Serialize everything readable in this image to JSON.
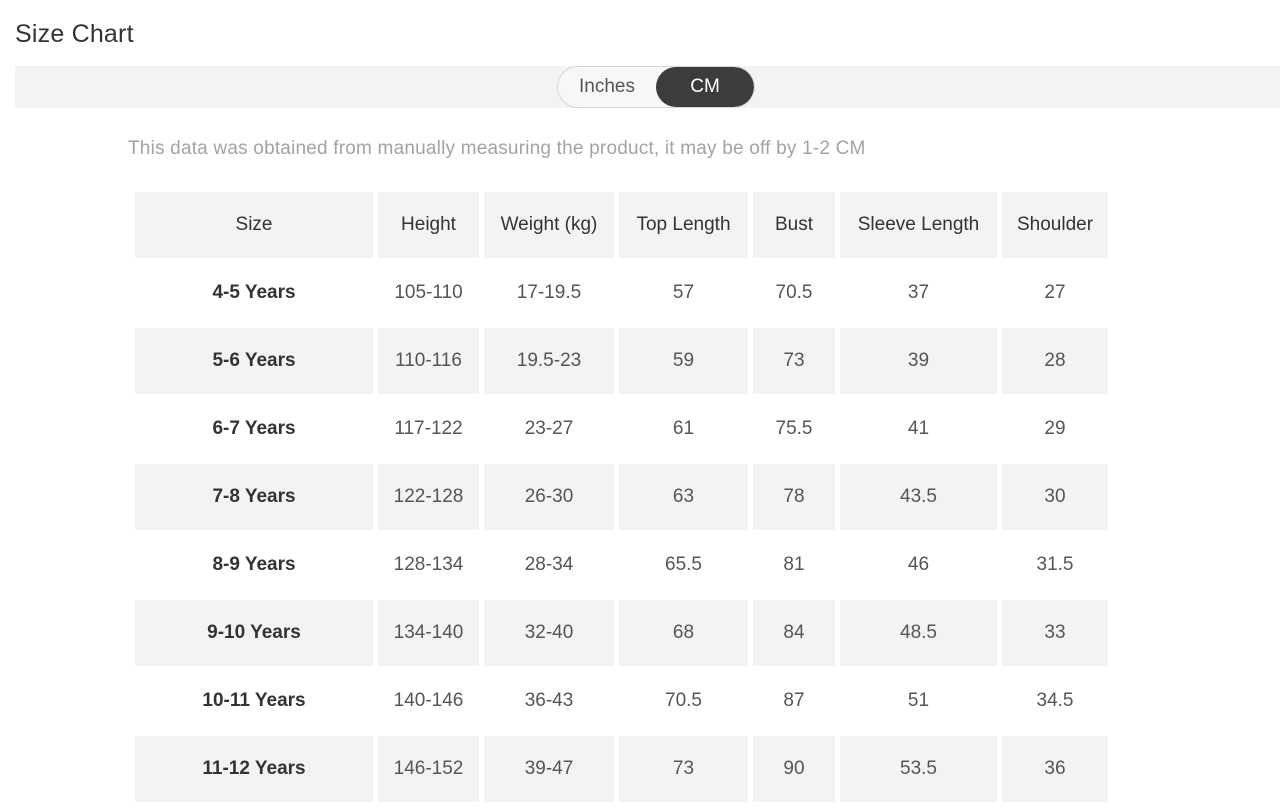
{
  "page": {
    "title": "Size Chart"
  },
  "unit_toggle": {
    "options": [
      "Inches",
      "CM"
    ],
    "selected": "CM"
  },
  "note": "This data was obtained from manually measuring the product, it may be off by 1-2 CM",
  "table": {
    "headers": [
      "Size",
      "Height",
      "Weight (kg)",
      "Top Length",
      "Bust",
      "Sleeve Length",
      "Shoulder"
    ],
    "rows": [
      [
        "4-5 Years",
        "105-110",
        "17-19.5",
        "57",
        "70.5",
        "37",
        "27"
      ],
      [
        "5-6 Years",
        "110-116",
        "19.5-23",
        "59",
        "73",
        "39",
        "28"
      ],
      [
        "6-7 Years",
        "117-122",
        "23-27",
        "61",
        "75.5",
        "41",
        "29"
      ],
      [
        "7-8 Years",
        "122-128",
        "26-30",
        "63",
        "78",
        "43.5",
        "30"
      ],
      [
        "8-9 Years",
        "128-134",
        "28-34",
        "65.5",
        "81",
        "46",
        "31.5"
      ],
      [
        "9-10 Years",
        "134-140",
        "32-40",
        "68",
        "84",
        "48.5",
        "33"
      ],
      [
        "10-11 Years",
        "140-146",
        "36-43",
        "70.5",
        "87",
        "51",
        "34.5"
      ],
      [
        "11-12 Years",
        "146-152",
        "39-47",
        "73",
        "90",
        "53.5",
        "36"
      ]
    ]
  },
  "colors": {
    "toggle_active_bg": "#3c3c3c",
    "stripe_bg": "#f2f3f2",
    "note_text": "#a3a3a3"
  }
}
